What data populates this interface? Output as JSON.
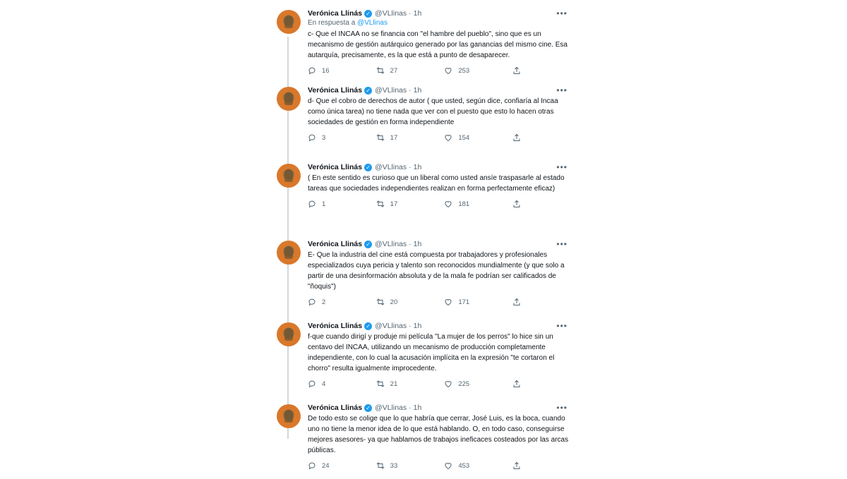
{
  "tweets": [
    {
      "name": "Verónica Llinás",
      "handle": "@VLlinas",
      "dot": "·",
      "time": "1h",
      "reply_prefix": "En respuesta a",
      "reply_mention": "@VLlinas",
      "text": "c- Que el INCAA no se financia con \"el hambre del pueblo\", sino que es un mecanismo de gestión autárquico generado por las ganancias del mismo cine. Esa autarquía, precisamente, es la que está a punto de desaparecer.",
      "replies": "16",
      "retweets": "27",
      "likes": "253"
    },
    {
      "name": "Verónica Llinás",
      "handle": "@VLlinas",
      "dot": "·",
      "time": "1h",
      "text": "d- Que el cobro de derechos de autor ( que usted, según dice, confiaría al Incaa como única tarea) no tiene nada que ver con el puesto que esto lo hacen otras sociedades de gestión en forma independiente",
      "replies": "3",
      "retweets": "17",
      "likes": "154"
    },
    {
      "name": "Verónica Llinás",
      "handle": "@VLlinas",
      "dot": "·",
      "time": "1h",
      "text": "( En este sentido es curioso que un liberal como usted ansíe traspasarle al estado tareas que sociedades independientes realizan en forma perfectamente eficaz)",
      "replies": "1",
      "retweets": "17",
      "likes": "181"
    },
    {
      "name": "Verónica Llinás",
      "handle": "@VLlinas",
      "dot": "·",
      "time": "1h",
      "text": "E- Que la industria del cine está compuesta por trabajadores y profesionales especializados cuya pericia y talento son reconocidos mundialmente (y que solo a partir de una desinformación absoluta y de la mala fe podrían ser calificados de \"ñoquis\")",
      "replies": "2",
      "retweets": "20",
      "likes": "171"
    },
    {
      "name": "Verónica Llinás",
      "handle": "@VLlinas",
      "dot": "·",
      "time": "1h",
      "text": "f-que cuando dirigí y produje mi película \"La mujer de los perros\" lo hice sin un centavo del INCAA, utilizando un mecanismo de producción completamente independiente, con lo cual la acusación implícita en la expresión \"te cortaron el chorro\" resulta igualmente improcedente.",
      "replies": "4",
      "retweets": "21",
      "likes": "225"
    },
    {
      "name": "Verónica Llinás",
      "handle": "@VLlinas",
      "dot": "·",
      "time": "1h",
      "text": "De todo esto se colige que lo que habría que cerrar, José Luis, es la boca, cuando uno no tiene la menor idea de lo que está hablando. O, en todo caso, conseguirse mejores asesores- ya que hablamos de trabajos ineficaces costeados por las arcas públicas.",
      "replies": "24",
      "retweets": "33",
      "likes": "453"
    }
  ],
  "colors": {
    "accent": "#1d9bf0",
    "secondary_text": "#536471",
    "thread_line": "#cfd9de"
  },
  "icons": [
    "verified-badge-icon",
    "more-icon",
    "reply-icon",
    "retweet-icon",
    "like-icon",
    "share-icon"
  ]
}
